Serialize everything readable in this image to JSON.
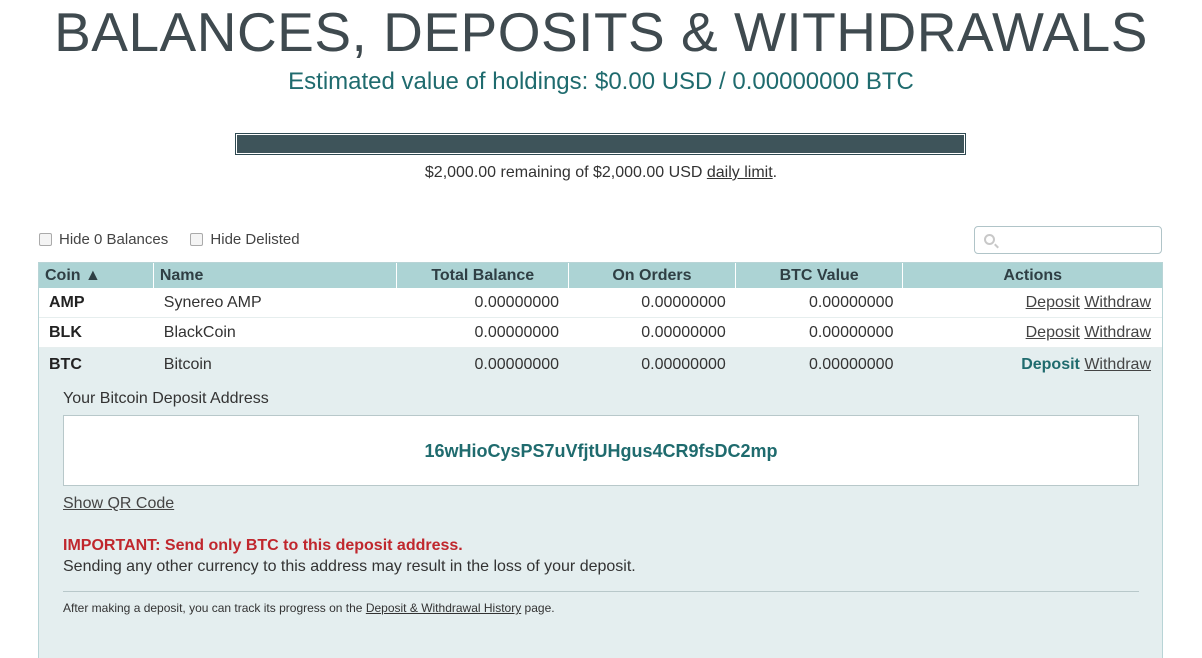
{
  "header": {
    "title": "BALANCES, DEPOSITS & WITHDRAWALS",
    "holdings": "Estimated value of holdings: $0.00 USD / 0.00000000 BTC"
  },
  "limit": {
    "remaining_fraction": 1.0,
    "text_before": "$2,000.00 remaining of $2,000.00 USD ",
    "link": "daily limit",
    "text_after": "."
  },
  "filters": {
    "hide_zero": "Hide 0 Balances",
    "hide_delisted": "Hide Delisted"
  },
  "search": {
    "placeholder": ""
  },
  "table": {
    "headers": {
      "coin": "Coin ▲",
      "name": "Name",
      "total": "Total Balance",
      "orders": "On Orders",
      "btc": "BTC Value",
      "actions": "Actions"
    },
    "rows": [
      {
        "coin": "AMP",
        "name": "Synereo AMP",
        "total": "0.00000000",
        "orders": "0.00000000",
        "btc": "0.00000000",
        "deposit": "Deposit",
        "withdraw": "Withdraw"
      },
      {
        "coin": "BLK",
        "name": "BlackCoin",
        "total": "0.00000000",
        "orders": "0.00000000",
        "btc": "0.00000000",
        "deposit": "Deposit",
        "withdraw": "Withdraw"
      },
      {
        "coin": "BTC",
        "name": "Bitcoin",
        "total": "0.00000000",
        "orders": "0.00000000",
        "btc": "0.00000000",
        "deposit": "Deposit",
        "withdraw": "Withdraw"
      }
    ]
  },
  "deposit": {
    "label": "Your Bitcoin Deposit Address",
    "address": "16wHioCysPS7uVfjtUHgus4CR9fsDC2mp",
    "qr_link": "Show QR Code",
    "important": "IMPORTANT: Send only BTC to this deposit address.",
    "warning": "Sending any other currency to this address may result in the loss of your deposit.",
    "track_before": "After making a deposit, you can track its progress on the ",
    "track_link": "Deposit & Withdrawal History",
    "track_after": " page."
  },
  "colors": {
    "accent": "#1f6b6e",
    "header_bg": "#acd3d4",
    "important": "#c0272d",
    "bar_fill": "#3e545a"
  }
}
